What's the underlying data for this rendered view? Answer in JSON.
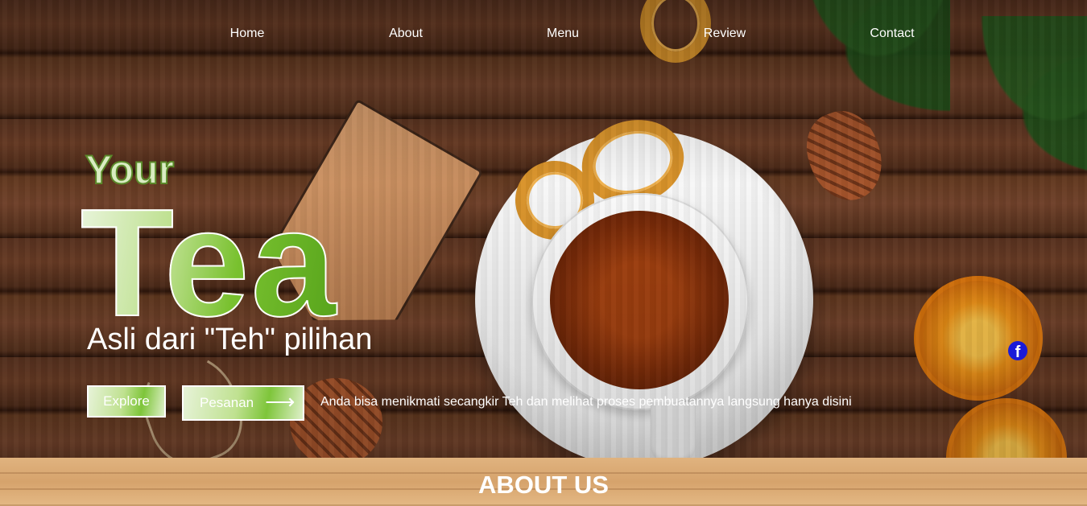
{
  "nav": {
    "items": [
      {
        "label": "Home"
      },
      {
        "label": "About"
      },
      {
        "label": "Menu"
      },
      {
        "label": "Review"
      },
      {
        "label": "Contact"
      }
    ]
  },
  "hero": {
    "kicker": "Your",
    "title": "Tea",
    "subtitle": "Asli dari \"Teh\" pilihan",
    "buttons": {
      "explore": "Explore",
      "pesanan": "Pesanan",
      "arrow": "⟶"
    },
    "tagline": "Anda bisa menikmati secangkir Teh dan melihat proses pembuatannya langsung hanya disini"
  },
  "social": {
    "facebook_icon": "facebook-icon",
    "facebook_glyph": "f",
    "color": "#1a1ad8"
  },
  "about": {
    "title": "ABOUT US"
  },
  "colors": {
    "nav_text": "#ffffff",
    "accent_green": "#79c12f",
    "wood_dark": "#5a3320",
    "wood_light": "#d6a36c"
  }
}
